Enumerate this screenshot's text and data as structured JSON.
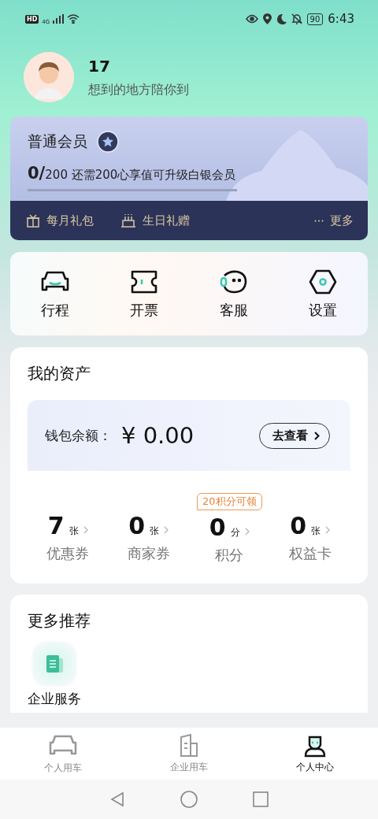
{
  "status_bar": {
    "hd": "HD",
    "network": "4G",
    "battery": "90",
    "time": "6:43"
  },
  "profile": {
    "name": "17",
    "slogan": "想到的地方陪你到"
  },
  "member": {
    "tier": "普通会员",
    "progress_text": "**0/**200 还需200心享值可升级白银会员",
    "level": 0,
    "perks": [
      {
        "label": "每月礼包",
        "kind": "gift"
      },
      {
        "label": "生日礼赠",
        "kind": "cake"
      }
    ],
    "more": "更多"
  },
  "quick_actions": [
    {
      "label": "行程",
      "kind": "car"
    },
    {
      "label": "开票",
      "kind": "ticket"
    },
    {
      "label": "客服",
      "kind": "service"
    },
    {
      "label": "设置",
      "kind": "settings"
    }
  ],
  "assets": {
    "title": "我的资产",
    "wallet_label": "钱包余额：",
    "wallet_amount": "¥ 0.00",
    "view_button": "去查看",
    "stats": [
      {
        "value": "7",
        "unit": "张",
        "label": "优惠券"
      },
      {
        "value": "0",
        "unit": "张",
        "label": "商家券"
      },
      {
        "value": "0",
        "unit": "分",
        "label": "积分",
        "badge": "20积分可领"
      },
      {
        "value": "0",
        "unit": "张",
        "label": "权益卡"
      }
    ]
  },
  "recommend": {
    "title": "更多推荐",
    "items": [
      {
        "label": "企业服务",
        "kind": "enterprise"
      }
    ]
  },
  "tabs": [
    {
      "label": "个人用车",
      "kind": "car",
      "selected": false
    },
    {
      "label": "企业用车",
      "kind": "building",
      "selected": false
    },
    {
      "label": "个人中心",
      "kind": "person",
      "selected": true
    }
  ]
}
